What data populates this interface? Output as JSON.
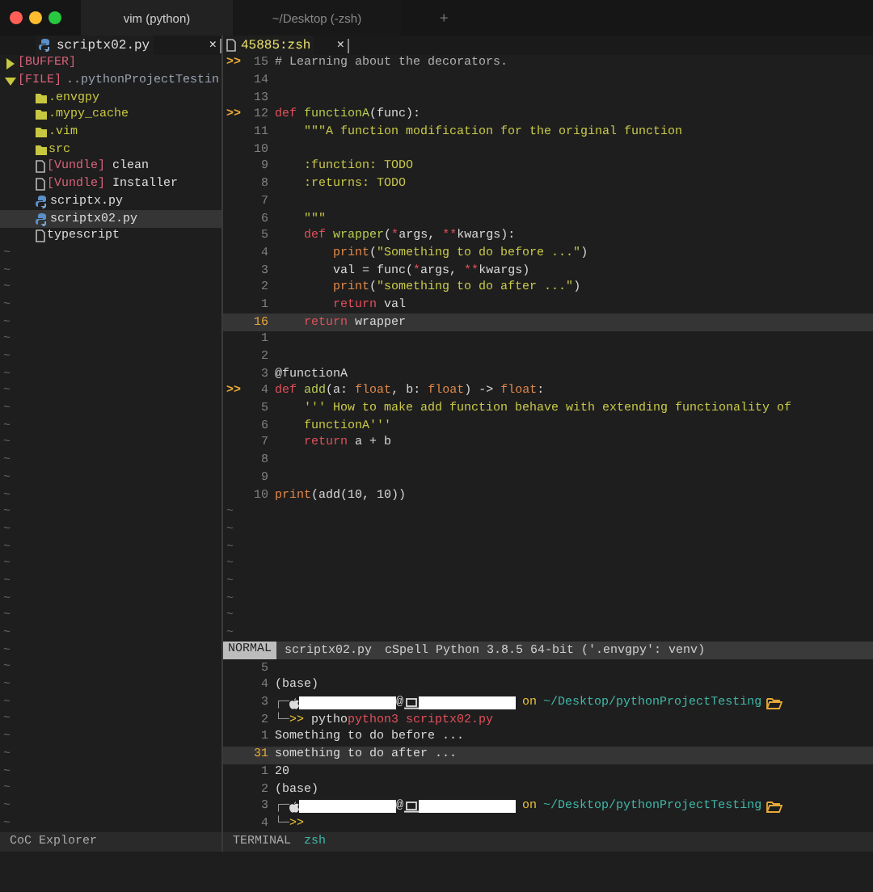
{
  "window": {
    "tabs": [
      {
        "label": "vim (python)",
        "selected": true
      },
      {
        "label": "~/Desktop (-zsh)",
        "selected": false
      }
    ],
    "new_tab": "+"
  },
  "explorer": {
    "tab": {
      "label": "scriptx02.py",
      "close": "×"
    },
    "tree": [
      {
        "label": "[BUFFER]",
        "expanded": false
      },
      {
        "label": "[FILE]",
        "path": "..pythonProjectTestin",
        "expanded": true,
        "children": [
          {
            "kind": "folder",
            "label": ".envgpy",
            "selected": false
          },
          {
            "kind": "folder",
            "label": ".mypy_cache",
            "selected": false
          },
          {
            "kind": "folder",
            "label": ".vim",
            "selected": false
          },
          {
            "kind": "folder",
            "label": "src",
            "selected": false
          },
          {
            "kind": "vundle",
            "tag": "[Vundle]",
            "label": "clean",
            "selected": false
          },
          {
            "kind": "vundle",
            "tag": "[Vundle]",
            "label": "Installer",
            "selected": false
          },
          {
            "kind": "python",
            "label": "scriptx.py",
            "selected": false
          },
          {
            "kind": "python",
            "label": "scriptx02.py",
            "selected": true
          },
          {
            "kind": "file",
            "label": "typescript",
            "selected": false
          }
        ]
      }
    ],
    "filler": [
      "~",
      "~",
      "~",
      "~",
      "~",
      "~",
      "~",
      "~",
      "~",
      "~",
      "~",
      "~",
      "~",
      "~",
      "~",
      "~",
      "~",
      "~",
      "~",
      "~",
      "~",
      "~",
      "~",
      "~",
      "~",
      "~",
      "~",
      "~",
      "~",
      "~",
      "~",
      "~",
      "~",
      "~"
    ],
    "footer": "CoC Explorer"
  },
  "editor": {
    "tab": {
      "label": "45885:zsh",
      "close": "×"
    },
    "lines": [
      {
        "number": "15",
        "mark": ">>",
        "current": false,
        "tokens": [
          {
            "kind": "comment",
            "text": "# Learning about the decorators."
          }
        ]
      },
      {
        "number": "14",
        "current": false
      },
      {
        "number": "13",
        "current": false
      },
      {
        "number": "12",
        "mark": ">>",
        "current": false,
        "tokens": [
          {
            "kind": "kw",
            "text": "def"
          },
          {
            "kind": "fn",
            "text": " functionA"
          },
          {
            "kind": "plain",
            "text": "(func):"
          }
        ]
      },
      {
        "number": "11",
        "current": false,
        "tokens": [
          {
            "kind": "str",
            "text": "    \"\"\"A function modification for the original function"
          }
        ]
      },
      {
        "number": "10",
        "current": false
      },
      {
        "number": "9",
        "current": false,
        "tokens": [
          {
            "kind": "str",
            "text": "    :function: TODO"
          }
        ]
      },
      {
        "number": "8",
        "current": false,
        "tokens": [
          {
            "kind": "str",
            "text": "    :returns: TODO"
          }
        ]
      },
      {
        "number": "7",
        "current": false
      },
      {
        "number": "6",
        "current": false,
        "tokens": [
          {
            "kind": "str",
            "text": "    \"\"\""
          }
        ]
      },
      {
        "number": "5",
        "current": false,
        "tokens": [
          {
            "kind": "kw",
            "text": "    def"
          },
          {
            "kind": "fn",
            "text": " wrapper"
          },
          {
            "kind": "plain",
            "text": "("
          },
          {
            "kind": "op",
            "text": "*"
          },
          {
            "kind": "plain",
            "text": "args, "
          },
          {
            "kind": "op",
            "text": "**"
          },
          {
            "kind": "plain",
            "text": "kwargs):"
          }
        ]
      },
      {
        "number": "4",
        "current": false,
        "tokens": [
          {
            "kind": "builtin",
            "text": "        print"
          },
          {
            "kind": "plain",
            "text": "("
          },
          {
            "kind": "str",
            "text": "\"Something to do before ...\""
          },
          {
            "kind": "plain",
            "text": ")"
          }
        ]
      },
      {
        "number": "3",
        "current": false,
        "tokens": [
          {
            "kind": "plain",
            "text": "        val = func("
          },
          {
            "kind": "op",
            "text": "*"
          },
          {
            "kind": "plain",
            "text": "args, "
          },
          {
            "kind": "op",
            "text": "**"
          },
          {
            "kind": "plain",
            "text": "kwargs)"
          }
        ]
      },
      {
        "number": "2",
        "current": false,
        "tokens": [
          {
            "kind": "builtin",
            "text": "        print"
          },
          {
            "kind": "plain",
            "text": "("
          },
          {
            "kind": "str",
            "text": "\"something to do after ...\""
          },
          {
            "kind": "plain",
            "text": ")"
          }
        ]
      },
      {
        "number": "1",
        "current": false,
        "tokens": [
          {
            "kind": "kw",
            "text": "        return"
          },
          {
            "kind": "plain",
            "text": " val"
          }
        ]
      },
      {
        "number": "16",
        "current": true,
        "tokens": [
          {
            "kind": "kw",
            "text": "    return"
          },
          {
            "kind": "plain",
            "text": " wrapper"
          }
        ]
      },
      {
        "number": "1",
        "current": false
      },
      {
        "number": "2",
        "current": false
      },
      {
        "number": "3",
        "current": false,
        "tokens": [
          {
            "kind": "plain",
            "text": "@functionA"
          }
        ]
      },
      {
        "number": "4",
        "mark": ">>",
        "current": false,
        "tokens": [
          {
            "kind": "kw",
            "text": "def"
          },
          {
            "kind": "fn",
            "text": " add"
          },
          {
            "kind": "plain",
            "text": "(a: "
          },
          {
            "kind": "type",
            "text": "float"
          },
          {
            "kind": "plain",
            "text": ", b: "
          },
          {
            "kind": "type",
            "text": "float"
          },
          {
            "kind": "plain",
            "text": ") -> "
          },
          {
            "kind": "type",
            "text": "float"
          },
          {
            "kind": "plain",
            "text": ":"
          }
        ]
      },
      {
        "number": "5",
        "current": false,
        "tokens": [
          {
            "kind": "str",
            "text": "    ''' How to make add function behave with extending functionality of"
          }
        ]
      },
      {
        "number": "6",
        "current": false,
        "tokens": [
          {
            "kind": "str",
            "text": "    functionA'''"
          }
        ]
      },
      {
        "number": "7",
        "current": false,
        "tokens": [
          {
            "kind": "kw",
            "text": "    return"
          },
          {
            "kind": "plain",
            "text": " a + b"
          }
        ]
      },
      {
        "number": "8",
        "current": false
      },
      {
        "number": "9",
        "current": false
      },
      {
        "number": "10",
        "current": false,
        "tokens": [
          {
            "kind": "builtin",
            "text": "print"
          },
          {
            "kind": "plain",
            "text": "(add(10, 10))"
          }
        ]
      }
    ],
    "filler": [
      "~",
      "~",
      "~",
      "~",
      "~",
      "~",
      "~",
      "~"
    ],
    "status": {
      "mode": "NORMAL",
      "file": "scriptx02.py",
      "info": "cSpell Python 3.8.5 64-bit ('.envgpy': venv)"
    },
    "terminal": [
      {
        "number": "5",
        "current": false
      },
      {
        "number": "4",
        "current": false,
        "tokens": [
          {
            "kind": "plain",
            "text": "(base)"
          }
        ]
      },
      {
        "number": "3",
        "current": false,
        "tokens": [
          {
            "kind": "box",
            "text": "┌─"
          },
          {
            "kind": "apple-icon"
          },
          {
            "kind": "redacted"
          },
          {
            "kind": "plain",
            "text": "@"
          },
          {
            "kind": "laptop-icon"
          },
          {
            "kind": "redacted"
          },
          {
            "kind": "accent",
            "text": " on"
          },
          {
            "kind": "path",
            "text": "~/Desktop/pythonProjectTesting"
          },
          {
            "kind": "folder-icon"
          }
        ]
      },
      {
        "number": "2",
        "current": false,
        "tokens": [
          {
            "kind": "box",
            "text": "└─"
          },
          {
            "kind": "accent",
            "text": ">>"
          },
          {
            "kind": "plain",
            "text": " pytho"
          },
          {
            "kind": "command",
            "text": "python3 scriptx02.py"
          }
        ]
      },
      {
        "number": "1",
        "current": false,
        "tokens": [
          {
            "kind": "plain",
            "text": "Something to do before ..."
          }
        ]
      },
      {
        "number": "31",
        "current": true,
        "tokens": [
          {
            "kind": "plain",
            "text": "something to do after ..."
          }
        ]
      },
      {
        "number": "1",
        "current": false,
        "tokens": [
          {
            "kind": "plain",
            "text": "20"
          }
        ]
      },
      {
        "number": "2",
        "current": false,
        "tokens": [
          {
            "kind": "plain",
            "text": "(base)"
          }
        ]
      },
      {
        "number": "3",
        "current": false,
        "tokens": [
          {
            "kind": "box",
            "text": "┌─"
          },
          {
            "kind": "apple-icon"
          },
          {
            "kind": "redacted"
          },
          {
            "kind": "plain",
            "text": "@"
          },
          {
            "kind": "laptop-icon"
          },
          {
            "kind": "redacted"
          },
          {
            "kind": "accent",
            "text": " on"
          },
          {
            "kind": "path",
            "text": "~/Desktop/pythonProjectTesting"
          },
          {
            "kind": "folder-icon"
          }
        ]
      },
      {
        "number": "4",
        "current": false,
        "tokens": [
          {
            "kind": "box",
            "text": "└─"
          },
          {
            "kind": "accent",
            "text": ">>"
          }
        ]
      }
    ],
    "footer": {
      "label": "TERMINAL",
      "shell": "zsh"
    }
  }
}
